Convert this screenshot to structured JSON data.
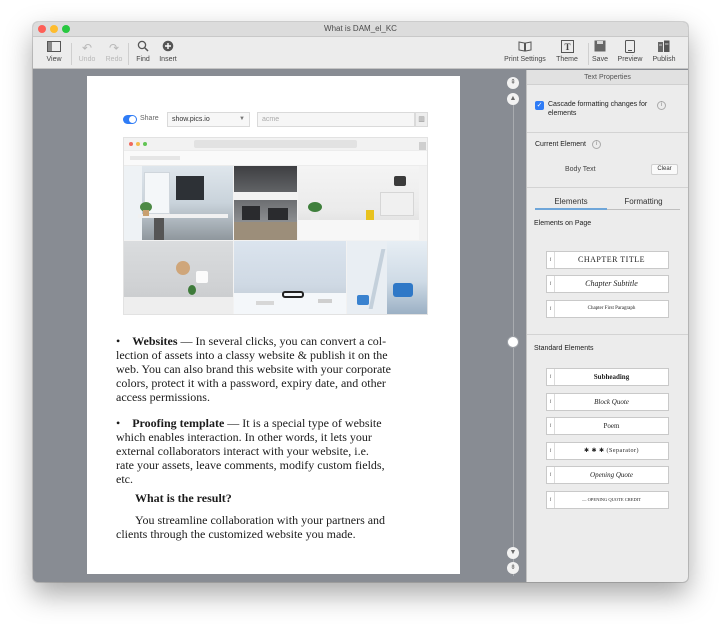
{
  "window": {
    "title": "What is DAM_el_KC"
  },
  "toolbar": {
    "view": {
      "label": "View",
      "icon": "sidebar-icon"
    },
    "undo": {
      "label": "Undo",
      "icon": "undo-icon"
    },
    "redo": {
      "label": "Redo",
      "icon": "redo-icon"
    },
    "find": {
      "label": "Find",
      "icon": "search-icon"
    },
    "insert": {
      "label": "Insert",
      "icon": "plus-circle-icon"
    },
    "print_settings": {
      "label": "Print Settings",
      "icon": "book-icon"
    },
    "theme": {
      "label": "Theme",
      "icon": "text-icon"
    },
    "save": {
      "label": "Save",
      "icon": "save-icon"
    },
    "preview": {
      "label": "Preview",
      "icon": "device-icon"
    },
    "publish": {
      "label": "Publish",
      "icon": "books-icon"
    }
  },
  "document": {
    "share_label": "Share",
    "domain_value": "show.pics.io",
    "slug_placeholder": "acme",
    "bullet1_title": "Websites",
    "bullet1_l1": "— In several clicks, you can convert a col-",
    "bullet1_l2": "lection of assets into a classy website & publish it on the",
    "bullet1_l3": "web. You can also brand this website with your corporate",
    "bullet1_l4": "colors, protect it with a password, expiry date, and other",
    "bullet1_l5": "access permissions.",
    "bullet2_title": "Proofing template",
    "bullet2_l1": "— It is a special type of website",
    "bullet2_l2": "which enables interaction. In other words, it lets your",
    "bullet2_l3": "external collaborators interact with your website, i.e.",
    "bullet2_l4": "rate your assets, leave comments, modify custom fields,",
    "bullet2_l5": "etc.",
    "heading": "What is the result?",
    "result_l1": "You streamline collaboration with your partners and",
    "result_l2": "clients through the customized website you made."
  },
  "sidebar": {
    "header": "Text Properties",
    "cascade_l1": "Cascade formatting changes for",
    "cascade_l2": "elements",
    "current_element_label": "Current Element",
    "current_element_value": "Body Text",
    "clear_label": "Clear",
    "tab_elements": "Elements",
    "tab_formatting": "Formatting",
    "elements_on_page_label": "Elements on Page",
    "page_elements": [
      "CHAPTER TITLE",
      "Chapter Subtitle",
      "Chapter First Paragraph"
    ],
    "standard_elements_label": "Standard Elements",
    "standard_elements": [
      "Subheading",
      "Block Quote",
      "Poem",
      "✱ ✱ ✱ (Separator)",
      "Opening Quote",
      "— OPENING QUOTE CREDIT"
    ]
  }
}
